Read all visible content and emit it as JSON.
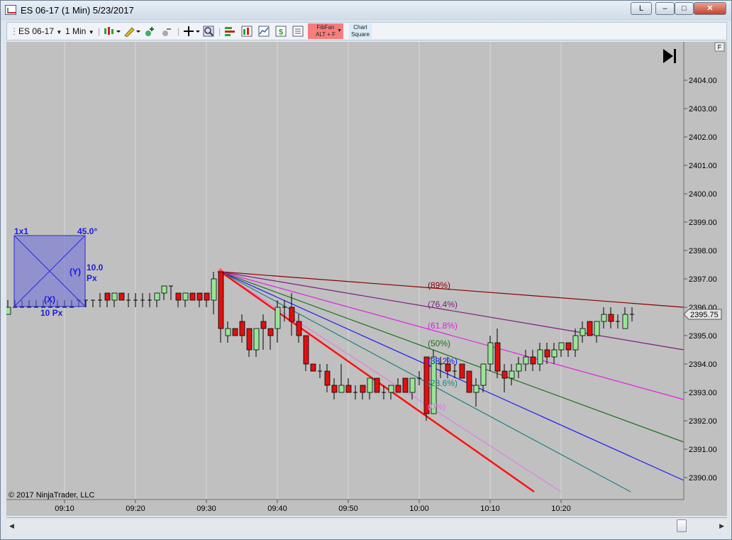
{
  "window": {
    "title": "ES 06-17 (1 Min)  5/23/2017",
    "controls": {
      "link": "L",
      "minimize": "–",
      "maximize": "□",
      "close": "✕"
    }
  },
  "toolbar": {
    "instrument": "ES 06-17",
    "interval": "1 Min",
    "fibfan_label": "FibFan",
    "fibfan_shortcut": "ALT + F",
    "chartsquare_line1": "Chart",
    "chartsquare_line2": "Square",
    "icons": [
      "chart-style-icon",
      "pencil-draw-icon",
      "add-indicator-icon",
      "remove-indicator-icon",
      "crosshair-icon",
      "zoom-icon",
      "strategies-icon",
      "bar-chart-icon",
      "line-chart-icon",
      "dollar-icon",
      "data-box-icon"
    ]
  },
  "chart": {
    "copyright": "© 2017 NinjaTrader, LLC",
    "price_marker": "2395.75",
    "panel_flag": "F",
    "square": {
      "ratio": "1x1",
      "angle": "45.0°",
      "y_label": "(Y)",
      "y_value": "10.0",
      "y_unit": "Px",
      "x_label": "(X)",
      "x_value": "10 Px"
    },
    "fib_labels": [
      "(89%)",
      "(76.4%)",
      "(61.8%)",
      "(50%)",
      "(38.2%)",
      "(23.6%)",
      "(0%)"
    ],
    "colors": {
      "up": "#98e698",
      "down": "#e01010",
      "background": "#c0c0c0"
    }
  },
  "chart_data": {
    "type": "candlestick",
    "x_ticks": [
      "09:10",
      "09:20",
      "09:30",
      "09:40",
      "09:50",
      "10:00",
      "10:10",
      "10:20"
    ],
    "y_ticks": [
      "2390.00",
      "2391.00",
      "2392.00",
      "2393.00",
      "2394.00",
      "2395.00",
      "2396.00",
      "2397.00",
      "2398.00",
      "2399.00",
      "2400.00",
      "2401.00",
      "2402.00",
      "2403.00",
      "2404.00"
    ],
    "ylim": [
      2389.5,
      2404.75
    ],
    "last_price": 2395.75,
    "fib_fan": {
      "origin": {
        "time": "09:32",
        "price": 2397.25
      },
      "levels": [
        89,
        76.4,
        61.8,
        50,
        38.2,
        23.6,
        0
      ]
    },
    "bars": [
      {
        "m": 540,
        "o": 2396.0,
        "h": 2396.0,
        "l": 2396.0,
        "c": 2396.0
      },
      {
        "m": 541,
        "o": 2396.0,
        "h": 2396.0,
        "l": 2395.75,
        "c": 2395.75
      },
      {
        "m": 542,
        "o": 2395.75,
        "h": 2396.25,
        "l": 2395.75,
        "c": 2396.0
      },
      {
        "m": 543,
        "o": 2396.0,
        "h": 2396.25,
        "l": 2396.0,
        "c": 2396.0
      },
      {
        "m": 544,
        "o": 2396.0,
        "h": 2396.25,
        "l": 2396.0,
        "c": 2396.0
      },
      {
        "m": 545,
        "o": 2396.0,
        "h": 2396.25,
        "l": 2396.0,
        "c": 2396.0
      },
      {
        "m": 546,
        "o": 2396.0,
        "h": 2396.25,
        "l": 2396.0,
        "c": 2396.0
      },
      {
        "m": 547,
        "o": 2396.0,
        "h": 2396.25,
        "l": 2396.0,
        "c": 2396.0
      },
      {
        "m": 548,
        "o": 2396.0,
        "h": 2396.25,
        "l": 2396.0,
        "c": 2396.0
      },
      {
        "m": 549,
        "o": 2396.0,
        "h": 2396.25,
        "l": 2396.0,
        "c": 2396.0
      },
      {
        "m": 550,
        "o": 2396.0,
        "h": 2396.25,
        "l": 2396.0,
        "c": 2396.0
      },
      {
        "m": 551,
        "o": 2396.0,
        "h": 2396.25,
        "l": 2396.0,
        "c": 2396.0
      },
      {
        "m": 552,
        "o": 2396.25,
        "h": 2396.25,
        "l": 2396.0,
        "c": 2396.25
      },
      {
        "m": 553,
        "o": 2396.25,
        "h": 2396.25,
        "l": 2396.0,
        "c": 2396.25
      },
      {
        "m": 554,
        "o": 2396.25,
        "h": 2396.25,
        "l": 2396.0,
        "c": 2396.25
      },
      {
        "m": 555,
        "o": 2396.25,
        "h": 2396.5,
        "l": 2396.0,
        "c": 2396.25
      },
      {
        "m": 556,
        "o": 2396.5,
        "h": 2396.5,
        "l": 2396.0,
        "c": 2396.25
      },
      {
        "m": 557,
        "o": 2396.25,
        "h": 2396.5,
        "l": 2396.0,
        "c": 2396.5
      },
      {
        "m": 558,
        "o": 2396.5,
        "h": 2396.5,
        "l": 2396.25,
        "c": 2396.25
      },
      {
        "m": 559,
        "o": 2396.25,
        "h": 2396.5,
        "l": 2396.0,
        "c": 2396.25
      },
      {
        "m": 560,
        "o": 2396.25,
        "h": 2396.5,
        "l": 2396.0,
        "c": 2396.25
      },
      {
        "m": 561,
        "o": 2396.25,
        "h": 2396.5,
        "l": 2396.0,
        "c": 2396.25
      },
      {
        "m": 562,
        "o": 2396.25,
        "h": 2396.5,
        "l": 2396.0,
        "c": 2396.25
      },
      {
        "m": 563,
        "o": 2396.25,
        "h": 2396.5,
        "l": 2396.0,
        "c": 2396.5
      },
      {
        "m": 564,
        "o": 2396.5,
        "h": 2396.75,
        "l": 2396.25,
        "c": 2396.75
      },
      {
        "m": 565,
        "o": 2396.75,
        "h": 2396.75,
        "l": 2396.25,
        "c": 2396.75
      },
      {
        "m": 566,
        "o": 2396.5,
        "h": 2396.5,
        "l": 2396.0,
        "c": 2396.25
      },
      {
        "m": 567,
        "o": 2396.25,
        "h": 2396.5,
        "l": 2396.0,
        "c": 2396.5
      },
      {
        "m": 568,
        "o": 2396.5,
        "h": 2396.5,
        "l": 2396.25,
        "c": 2396.25
      },
      {
        "m": 569,
        "o": 2396.5,
        "h": 2396.5,
        "l": 2396.0,
        "c": 2396.25
      },
      {
        "m": 570,
        "o": 2396.5,
        "h": 2396.5,
        "l": 2396.0,
        "c": 2396.25
      },
      {
        "m": 571,
        "o": 2396.25,
        "h": 2397.25,
        "l": 2395.75,
        "c": 2397.0
      },
      {
        "m": 572,
        "o": 2397.25,
        "h": 2397.25,
        "l": 2394.75,
        "c": 2395.25
      },
      {
        "m": 573,
        "o": 2395.0,
        "h": 2395.5,
        "l": 2394.75,
        "c": 2395.25
      },
      {
        "m": 574,
        "o": 2395.25,
        "h": 2395.25,
        "l": 2395.0,
        "c": 2395.0
      },
      {
        "m": 575,
        "o": 2395.5,
        "h": 2395.75,
        "l": 2394.75,
        "c": 2395.0
      },
      {
        "m": 576,
        "o": 2395.25,
        "h": 2395.25,
        "l": 2394.25,
        "c": 2394.5
      },
      {
        "m": 577,
        "o": 2394.5,
        "h": 2395.25,
        "l": 2394.25,
        "c": 2395.25
      },
      {
        "m": 578,
        "o": 2395.5,
        "h": 2395.75,
        "l": 2394.5,
        "c": 2395.25
      },
      {
        "m": 579,
        "o": 2395.25,
        "h": 2395.25,
        "l": 2394.5,
        "c": 2395.0
      },
      {
        "m": 580,
        "o": 2395.25,
        "h": 2396.25,
        "l": 2394.75,
        "c": 2396.0
      },
      {
        "m": 581,
        "o": 2396.0,
        "h": 2396.25,
        "l": 2395.5,
        "c": 2396.0
      },
      {
        "m": 582,
        "o": 2396.0,
        "h": 2396.5,
        "l": 2395.0,
        "c": 2395.5
      },
      {
        "m": 583,
        "o": 2395.5,
        "h": 2395.75,
        "l": 2394.75,
        "c": 2395.0
      },
      {
        "m": 584,
        "o": 2395.0,
        "h": 2395.0,
        "l": 2393.75,
        "c": 2394.0
      },
      {
        "m": 585,
        "o": 2394.0,
        "h": 2394.0,
        "l": 2393.75,
        "c": 2393.75
      },
      {
        "m": 586,
        "o": 2393.75,
        "h": 2394.0,
        "l": 2393.5,
        "c": 2393.75
      },
      {
        "m": 587,
        "o": 2393.75,
        "h": 2394.0,
        "l": 2393.0,
        "c": 2393.25
      },
      {
        "m": 588,
        "o": 2393.25,
        "h": 2393.5,
        "l": 2392.75,
        "c": 2393.0
      },
      {
        "m": 589,
        "o": 2393.0,
        "h": 2394.0,
        "l": 2393.0,
        "c": 2393.25
      },
      {
        "m": 590,
        "o": 2393.25,
        "h": 2393.5,
        "l": 2393.0,
        "c": 2393.0
      },
      {
        "m": 591,
        "o": 2393.0,
        "h": 2393.25,
        "l": 2392.75,
        "c": 2393.0
      },
      {
        "m": 592,
        "o": 2393.25,
        "h": 2393.25,
        "l": 2392.75,
        "c": 2393.0
      },
      {
        "m": 593,
        "o": 2393.0,
        "h": 2393.5,
        "l": 2392.75,
        "c": 2393.5
      },
      {
        "m": 594,
        "o": 2393.5,
        "h": 2393.5,
        "l": 2393.0,
        "c": 2393.0
      },
      {
        "m": 595,
        "o": 2393.0,
        "h": 2393.25,
        "l": 2392.75,
        "c": 2393.0
      },
      {
        "m": 596,
        "o": 2393.0,
        "h": 2393.25,
        "l": 2392.75,
        "c": 2393.25
      },
      {
        "m": 597,
        "o": 2393.25,
        "h": 2393.5,
        "l": 2393.0,
        "c": 2393.0
      },
      {
        "m": 598,
        "o": 2393.5,
        "h": 2393.5,
        "l": 2393.0,
        "c": 2393.0
      },
      {
        "m": 599,
        "o": 2393.0,
        "h": 2393.5,
        "l": 2392.75,
        "c": 2393.5
      },
      {
        "m": 600,
        "o": 2393.5,
        "h": 2393.75,
        "l": 2393.25,
        "c": 2393.5
      },
      {
        "m": 601,
        "o": 2394.25,
        "h": 2394.25,
        "l": 2392.0,
        "c": 2392.25
      },
      {
        "m": 602,
        "o": 2392.25,
        "h": 2394.5,
        "l": 2392.25,
        "c": 2394.25
      },
      {
        "m": 603,
        "o": 2394.0,
        "h": 2394.25,
        "l": 2393.5,
        "c": 2394.0
      },
      {
        "m": 604,
        "o": 2394.0,
        "h": 2394.25,
        "l": 2393.5,
        "c": 2393.75
      },
      {
        "m": 605,
        "o": 2393.75,
        "h": 2394.0,
        "l": 2393.5,
        "c": 2393.75
      },
      {
        "m": 606,
        "o": 2394.0,
        "h": 2394.0,
        "l": 2393.5,
        "c": 2393.5
      },
      {
        "m": 607,
        "o": 2393.75,
        "h": 2393.75,
        "l": 2393.0,
        "c": 2393.0
      },
      {
        "m": 608,
        "o": 2393.0,
        "h": 2393.5,
        "l": 2392.5,
        "c": 2393.25
      },
      {
        "m": 609,
        "o": 2393.25,
        "h": 2394.0,
        "l": 2393.0,
        "c": 2394.0
      },
      {
        "m": 610,
        "o": 2394.0,
        "h": 2395.0,
        "l": 2393.75,
        "c": 2394.75
      },
      {
        "m": 611,
        "o": 2394.75,
        "h": 2395.25,
        "l": 2393.5,
        "c": 2393.75
      },
      {
        "m": 612,
        "o": 2393.75,
        "h": 2394.0,
        "l": 2393.0,
        "c": 2393.5
      },
      {
        "m": 613,
        "o": 2393.5,
        "h": 2394.0,
        "l": 2393.25,
        "c": 2393.75
      },
      {
        "m": 614,
        "o": 2393.75,
        "h": 2394.25,
        "l": 2393.5,
        "c": 2394.0
      },
      {
        "m": 615,
        "o": 2394.0,
        "h": 2394.5,
        "l": 2393.75,
        "c": 2394.25
      },
      {
        "m": 616,
        "o": 2394.25,
        "h": 2394.5,
        "l": 2393.75,
        "c": 2394.0
      },
      {
        "m": 617,
        "o": 2394.0,
        "h": 2394.75,
        "l": 2393.75,
        "c": 2394.5
      },
      {
        "m": 618,
        "o": 2394.5,
        "h": 2394.75,
        "l": 2394.0,
        "c": 2394.25
      },
      {
        "m": 619,
        "o": 2394.25,
        "h": 2394.75,
        "l": 2394.0,
        "c": 2394.5
      },
      {
        "m": 620,
        "o": 2394.5,
        "h": 2394.75,
        "l": 2394.25,
        "c": 2394.75
      },
      {
        "m": 621,
        "o": 2394.75,
        "h": 2394.75,
        "l": 2394.25,
        "c": 2394.5
      },
      {
        "m": 622,
        "o": 2394.5,
        "h": 2395.25,
        "l": 2394.25,
        "c": 2395.0
      },
      {
        "m": 623,
        "o": 2395.0,
        "h": 2395.5,
        "l": 2394.75,
        "c": 2395.25
      },
      {
        "m": 624,
        "o": 2395.5,
        "h": 2395.5,
        "l": 2395.0,
        "c": 2395.0
      },
      {
        "m": 625,
        "o": 2395.0,
        "h": 2395.5,
        "l": 2394.75,
        "c": 2395.5
      },
      {
        "m": 626,
        "o": 2395.5,
        "h": 2396.0,
        "l": 2395.25,
        "c": 2395.75
      },
      {
        "m": 627,
        "o": 2395.75,
        "h": 2396.0,
        "l": 2395.25,
        "c": 2395.5
      },
      {
        "m": 628,
        "o": 2395.5,
        "h": 2395.75,
        "l": 2395.25,
        "c": 2395.5
      },
      {
        "m": 629,
        "o": 2395.25,
        "h": 2396.0,
        "l": 2395.25,
        "c": 2395.75
      },
      {
        "m": 630,
        "o": 2395.75,
        "h": 2396.0,
        "l": 2395.5,
        "c": 2395.75
      }
    ]
  }
}
